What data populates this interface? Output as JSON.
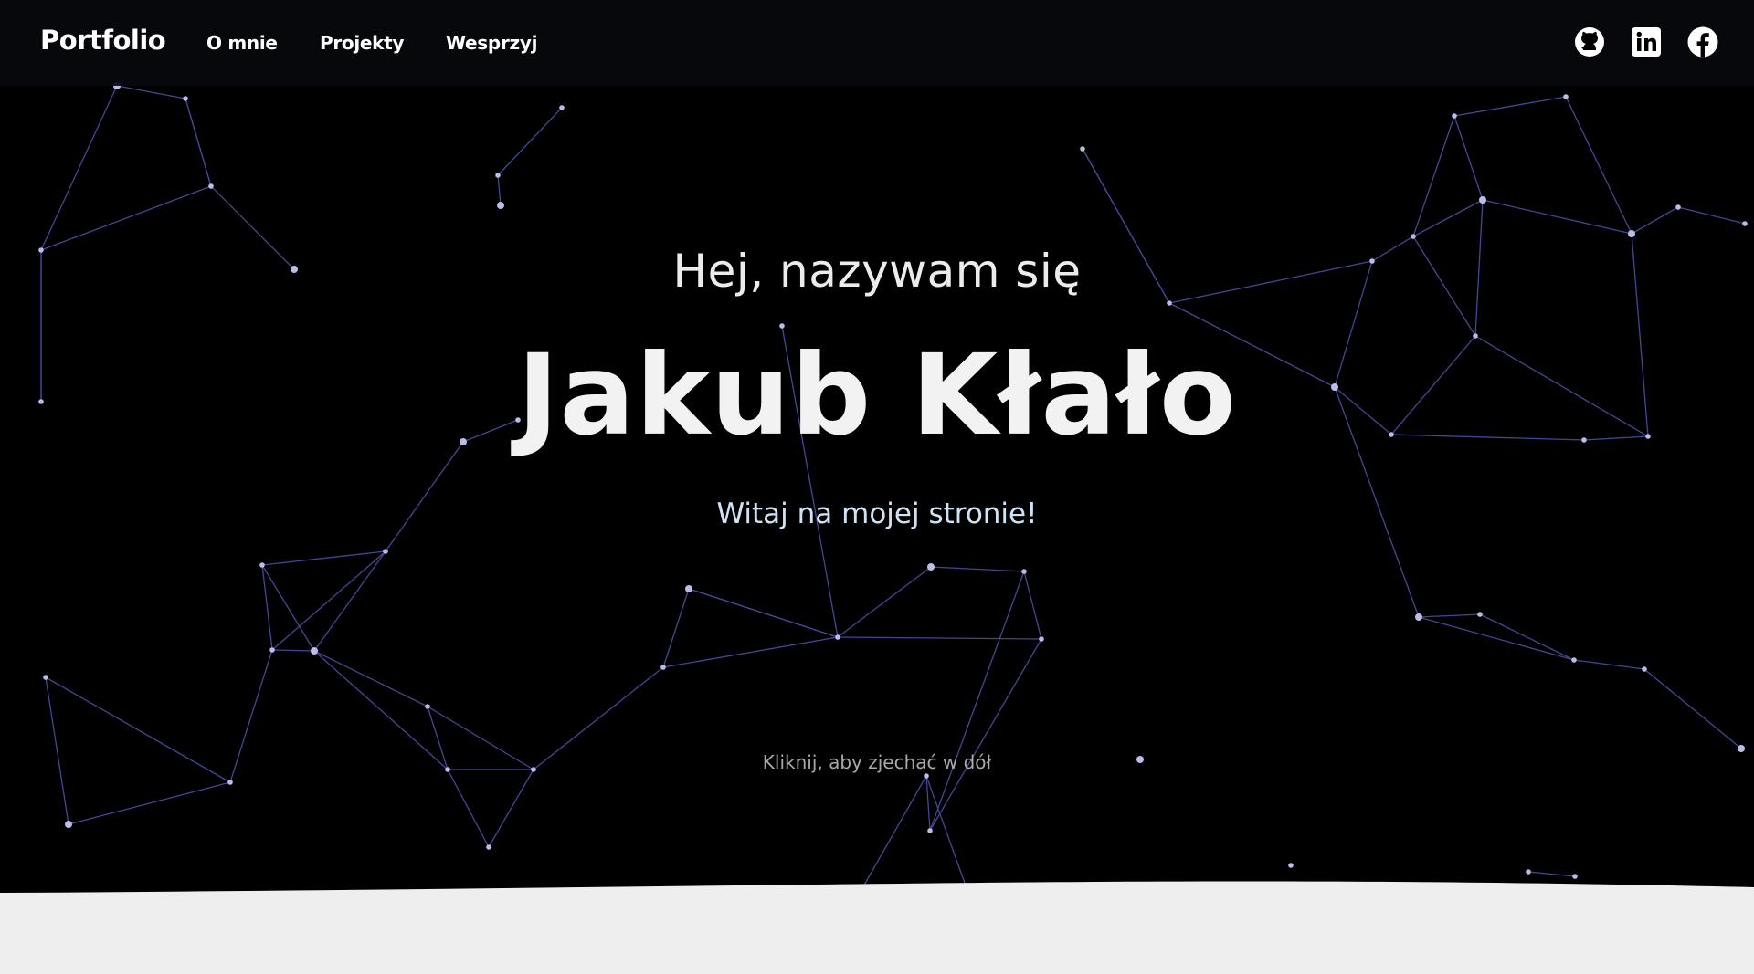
{
  "navbar": {
    "brand": "Portfolio",
    "links": [
      {
        "label": "O mnie"
      },
      {
        "label": "Projekty"
      },
      {
        "label": "Wesprzyj"
      }
    ],
    "social": [
      {
        "icon": "github-icon"
      },
      {
        "icon": "linkedin-icon"
      },
      {
        "icon": "facebook-icon"
      }
    ]
  },
  "hero": {
    "greeting": "Hej, nazywam się",
    "name": "Jakub Kłało",
    "welcome": "Witaj na mojej stronie!",
    "scroll_hint": "Kliknij, aby zjechać w dół"
  },
  "colors": {
    "background": "#000000",
    "network_line": "#5b5fc7",
    "network_node": "#b9bde8",
    "wave": "#eeeeee",
    "welcome_text": "#cfe3f5"
  }
}
